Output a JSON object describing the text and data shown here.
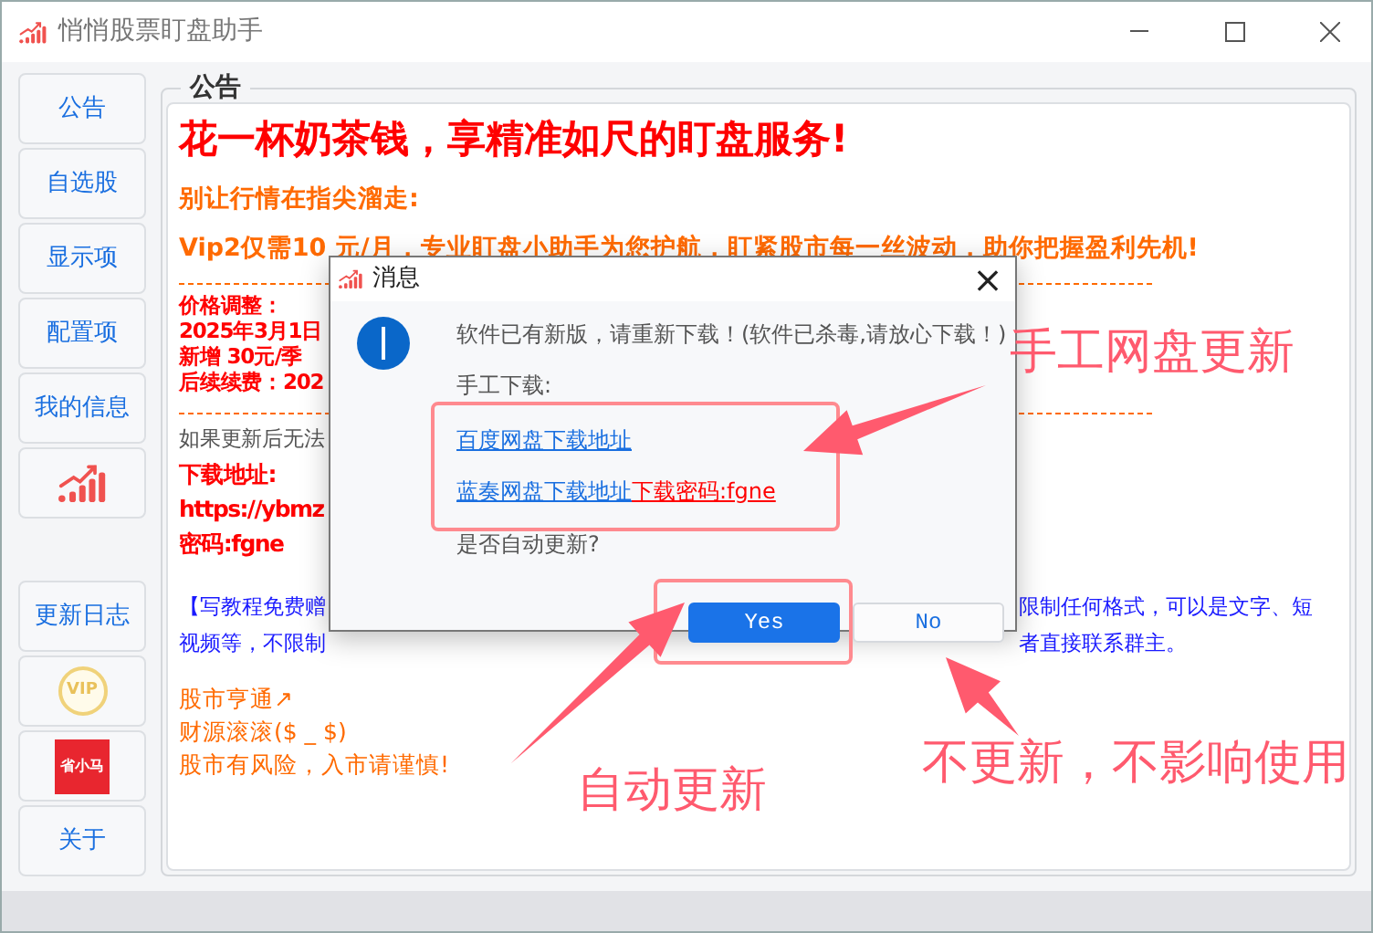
{
  "window": {
    "title": "悄悄股票盯盘助手"
  },
  "sidebar": {
    "top_items": [
      {
        "kind": "text",
        "label": "公告"
      },
      {
        "kind": "text",
        "label": "自选股"
      },
      {
        "kind": "text",
        "label": "显示项"
      },
      {
        "kind": "text",
        "label": "配置项"
      },
      {
        "kind": "text",
        "label": "我的信息"
      },
      {
        "kind": "chart"
      }
    ],
    "bottom_items": [
      {
        "kind": "text",
        "label": "更新日志"
      },
      {
        "kind": "vip",
        "label": "VIP"
      },
      {
        "kind": "logo",
        "label": "省小马"
      },
      {
        "kind": "text",
        "label": "关于"
      }
    ]
  },
  "notice": {
    "title": "公告",
    "blocks": [
      {
        "kind": "headline",
        "lines": [
          {
            "text": "花一杯奶茶钱，享精准如尺的盯盘服务!"
          }
        ]
      },
      {
        "kind": "slogan",
        "lines": [
          {
            "text": "别让行情在指尖溜走:"
          }
        ]
      },
      {
        "kind": "slogan",
        "lines": [
          {
            "text": "Vip2仅需10 元/月，专业盯盘小助手为您护航，盯紧股市每一丝波动，助你把握盈利先机!"
          }
        ]
      },
      {
        "kind": "divider"
      },
      {
        "kind": "price",
        "lines": [
          {
            "text": "价格调整："
          },
          {
            "text": "2025年3月1日"
          },
          {
            "text": "新增  30元/季"
          },
          {
            "text": "后续续费：202"
          }
        ]
      },
      {
        "kind": "divider"
      },
      {
        "kind": "note",
        "lines": [
          {
            "text": "如果更新后无法"
          }
        ]
      },
      {
        "kind": "download",
        "lines": [
          {
            "text": "下载地址:"
          },
          {
            "text": "https://ybmz"
          },
          {
            "text": "密码:fgne"
          }
        ]
      },
      {
        "kind": "promo",
        "lines": [
          {
            "text": "【写教程免费赠",
            "text_right": "限制任何格式，可以是文字、短"
          },
          {
            "text": "视频等，不限制",
            "text_right": "者直接联系群主。"
          }
        ]
      },
      {
        "kind": "wish",
        "lines": [
          {
            "text": "股市亨通↗"
          },
          {
            "text": "财源滚滚($ _ $)"
          },
          {
            "text": "股市有风险，入市请谨慎!"
          }
        ]
      }
    ]
  },
  "dialog": {
    "title": "消息",
    "close": "×",
    "message": "软件已有新版，请重新下载！(软件已杀毒,请放心下载！)",
    "manual_label": "手工下载:",
    "links": [
      {
        "text": "百度网盘下载地址 "
      },
      {
        "text": "蓝奏网盘下载地址",
        "extra": "下载密码:fgne"
      }
    ],
    "question": "是否自动更新?",
    "buttons": [
      {
        "label": "Yes",
        "selected": true
      },
      {
        "label": "No",
        "selected": false
      }
    ]
  },
  "annotations": [
    {
      "text": "手工网盘更新"
    },
    {
      "text": "自动更新"
    },
    {
      "text": "不更新，不影响使用"
    }
  ]
}
